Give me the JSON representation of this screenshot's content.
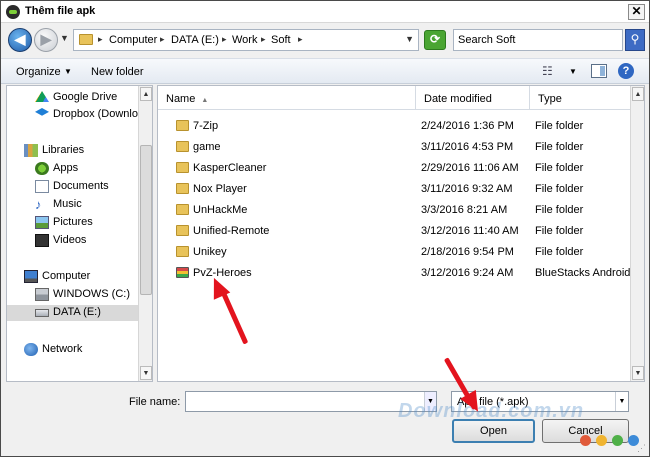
{
  "window": {
    "title": "Thêm file apk",
    "close_label": "✕"
  },
  "nav_buttons": {
    "back": "◀",
    "forward": "▶",
    "history": "▼"
  },
  "breadcrumb": {
    "segments": [
      "Computer",
      "DATA (E:)",
      "Work",
      "Soft"
    ],
    "separator": "▸"
  },
  "search": {
    "placeholder": "Search Soft"
  },
  "toolbar": {
    "organize_label": "Organize",
    "new_folder_label": "New folder",
    "help_label": "?"
  },
  "nav_pane": {
    "items": [
      {
        "label": "Google Drive",
        "icon": "google-drive-icon"
      },
      {
        "label": "Dropbox (Downloa",
        "icon": "dropbox-icon"
      },
      {
        "label": "Libraries",
        "icon": "libraries-icon"
      },
      {
        "label": "Apps",
        "icon": "apps-icon"
      },
      {
        "label": "Documents",
        "icon": "documents-icon"
      },
      {
        "label": "Music",
        "icon": "music-icon"
      },
      {
        "label": "Pictures",
        "icon": "pictures-icon"
      },
      {
        "label": "Videos",
        "icon": "videos-icon"
      },
      {
        "label": "Computer",
        "icon": "computer-icon"
      },
      {
        "label": "WINDOWS (C:)",
        "icon": "drive-icon"
      },
      {
        "label": "DATA (E:)",
        "icon": "drive-icon"
      },
      {
        "label": "Network",
        "icon": "network-icon"
      }
    ]
  },
  "file_list": {
    "columns": {
      "name": "Name",
      "date": "Date modified",
      "type": "Type"
    },
    "rows": [
      {
        "name": "7-Zip",
        "date": "2/24/2016 1:36 PM",
        "type": "File folder"
      },
      {
        "name": "game",
        "date": "3/11/2016 4:53 PM",
        "type": "File folder"
      },
      {
        "name": "KasperCleaner",
        "date": "2/29/2016 11:06 AM",
        "type": "File folder"
      },
      {
        "name": "Nox Player",
        "date": "3/11/2016 9:32 AM",
        "type": "File folder"
      },
      {
        "name": "UnHackMe",
        "date": "3/3/2016 8:21 AM",
        "type": "File folder"
      },
      {
        "name": "Unified-Remote",
        "date": "3/12/2016 11:40 AM",
        "type": "File folder"
      },
      {
        "name": "Unikey",
        "date": "2/18/2016 9:54 PM",
        "type": "File folder"
      },
      {
        "name": "PvZ-Heroes",
        "date": "3/12/2016 9:24 AM",
        "type": "BlueStacks Android ..."
      }
    ]
  },
  "bottom": {
    "file_name_label": "File name:",
    "file_name_value": "",
    "file_type_value": "Apk file (*.apk)",
    "open_label": "Open",
    "cancel_label": "Cancel"
  },
  "watermark": {
    "text": "Download.com.vn"
  },
  "colors": {
    "accent": "#3c7fb1",
    "arrow": "#e3141e",
    "folder": "#e8c35a",
    "selected": "#d9d9d9"
  }
}
